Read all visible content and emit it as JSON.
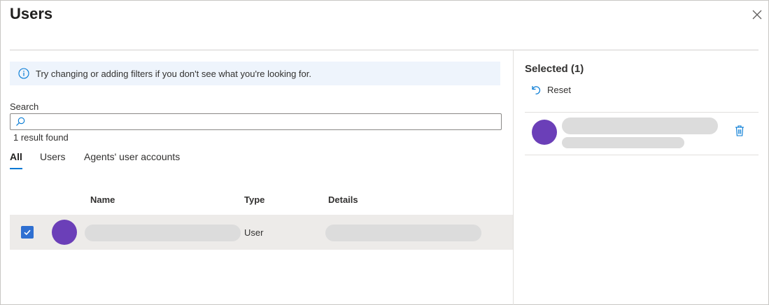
{
  "dialog": {
    "title": "Users",
    "close_icon": "close-icon"
  },
  "info": {
    "icon": "info-icon",
    "message": "Try changing or adding filters if you don't see what you're looking for."
  },
  "search": {
    "label": "Search",
    "value": "",
    "placeholder": "",
    "icon": "search-icon",
    "result_text": "1 result found"
  },
  "tabs": [
    {
      "label": "All",
      "active": true
    },
    {
      "label": "Users",
      "active": false
    },
    {
      "label": "Agents' user accounts",
      "active": false
    }
  ],
  "table": {
    "columns": [
      "Name",
      "Type",
      "Details"
    ],
    "rows": [
      {
        "selected": true,
        "name": "",
        "type": "User",
        "details": ""
      }
    ]
  },
  "selected_panel": {
    "title": "Selected (1)",
    "reset_label": "Reset",
    "reset_icon": "undo-icon",
    "delete_icon": "trash-icon"
  },
  "colors": {
    "accent": "#0078d4",
    "checkbox": "#2f6fd1",
    "avatar": "#6b3fb8",
    "info_bg": "#eef4fc",
    "row_selected_bg": "#edebe9",
    "placeholder": "#dcdcdc"
  }
}
